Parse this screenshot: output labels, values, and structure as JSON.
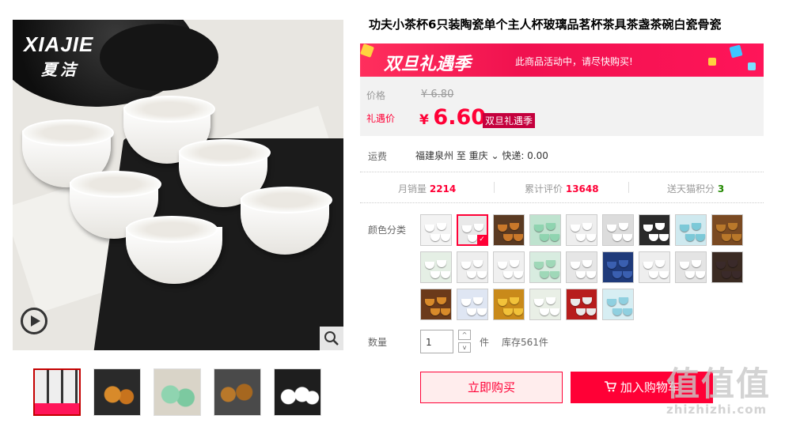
{
  "product": {
    "title": "功夫小茶杯6只装陶瓷单个主人杯玻璃品茗杯茶具茶盏茶碗白瓷骨瓷",
    "brand_logo_en": "XIAJIE",
    "brand_logo_cn": "夏洁"
  },
  "promo": {
    "banner_text": "双旦礼遇季",
    "message": "此商品活动中，请尽快购买!"
  },
  "price": {
    "label": "价格",
    "original": "¥ 6.80",
    "deal_label": "礼遇价",
    "currency": "¥",
    "current": "6.60",
    "tag": "双旦礼遇季"
  },
  "shipping": {
    "label": "运费",
    "text": "福建泉州 至 重庆 ⌄ 快递: 0.00"
  },
  "stats": {
    "monthly_sales_label": "月销量",
    "monthly_sales": "2214",
    "reviews_label": "累计评价",
    "reviews": "13648",
    "points_label": "送天猫积分",
    "points": "3"
  },
  "options": {
    "label": "颜色分类",
    "selected_index": 1,
    "swatch_count": 24
  },
  "quantity": {
    "label": "数量",
    "value": "1",
    "up": "^",
    "down": "v",
    "unit": "件",
    "stock": "库存561件"
  },
  "actions": {
    "buy_now": "立即购买",
    "add_to_cart": "加入购物车"
  },
  "watermark": {
    "cn": "值值值",
    "url": "zhizhizhi.com"
  },
  "colors": {
    "accent": "#ff0036",
    "promo": "#ff1559"
  },
  "icons": {
    "play": "play-icon",
    "zoom": "magnifier-icon",
    "cart": "cart-icon"
  }
}
